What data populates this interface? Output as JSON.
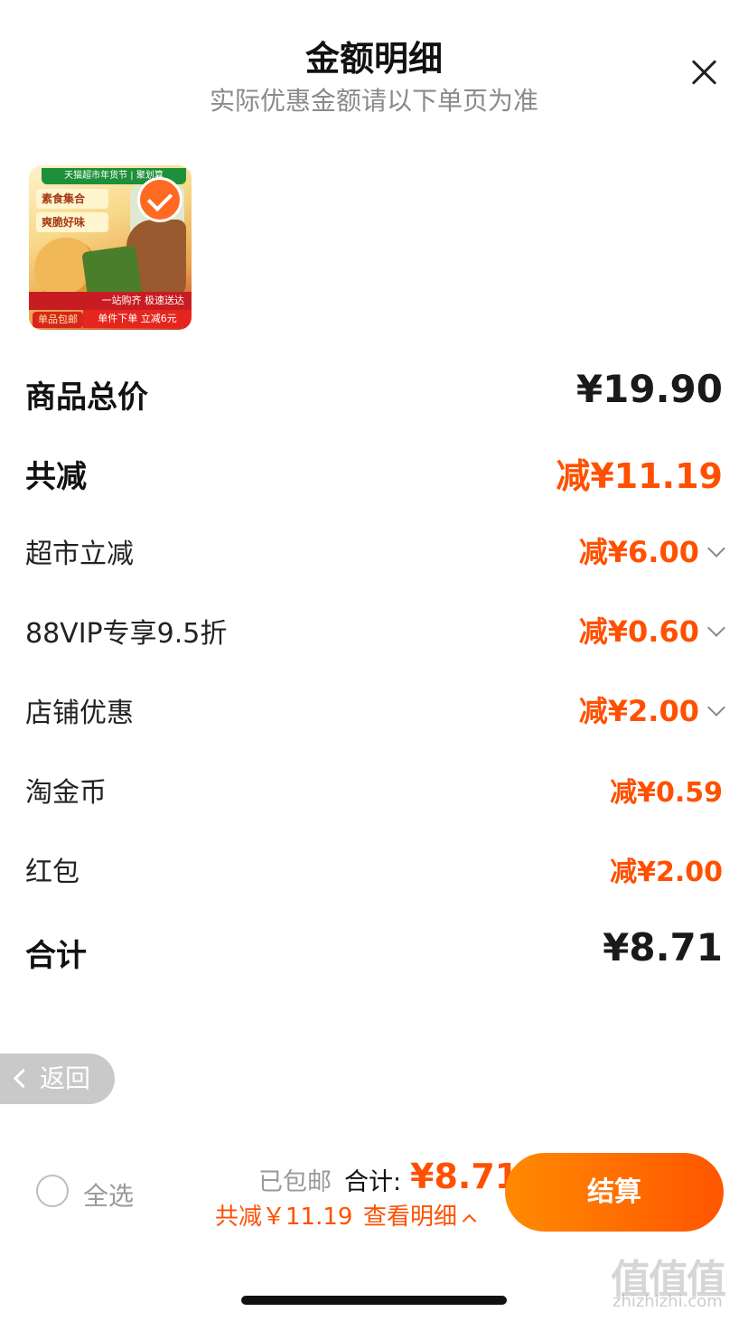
{
  "header": {
    "title": "金额明细",
    "subtitle": "实际优惠金额请以下单页为准"
  },
  "product": {
    "image_texts": {
      "banner": "天猫超市年货节 | 聚划算",
      "tag1": "素食集合",
      "tag2": "爽脆好味",
      "strip": "一站购齐 极速送达",
      "strip2": "单件下单 立减6元",
      "mail": "单品包邮"
    },
    "selected": true
  },
  "rows": {
    "total_price": {
      "label": "商品总价",
      "value": "¥19.90"
    },
    "total_discount": {
      "label": "共减",
      "value": "减¥11.19"
    },
    "items": [
      {
        "label": "超市立减",
        "value": "减¥6.00",
        "expandable": true
      },
      {
        "label": "88VIP专享9.5折",
        "value": "减¥0.60",
        "expandable": true
      },
      {
        "label": "店铺优惠",
        "value": "减¥2.00",
        "expandable": true
      },
      {
        "label": "淘金币",
        "value": "减¥0.59",
        "expandable": false
      },
      {
        "label": "红包",
        "value": "减¥2.00",
        "expandable": false
      }
    ],
    "sum": {
      "label": "合计",
      "value": "¥8.71"
    }
  },
  "back_button": {
    "label": "返回"
  },
  "bottom_bar": {
    "select_all": "全选",
    "shipping": "已包邮",
    "total_label": "合计:",
    "total_value": "¥8.71",
    "saved": "共减￥11.19",
    "detail_link": "查看明细",
    "checkout": "结算"
  },
  "watermark": {
    "logo": "值值值",
    "url": "zhizhizhi.com"
  },
  "colors": {
    "accent": "#ff5000",
    "button_start": "#ff8a00",
    "button_end": "#ff5500"
  }
}
